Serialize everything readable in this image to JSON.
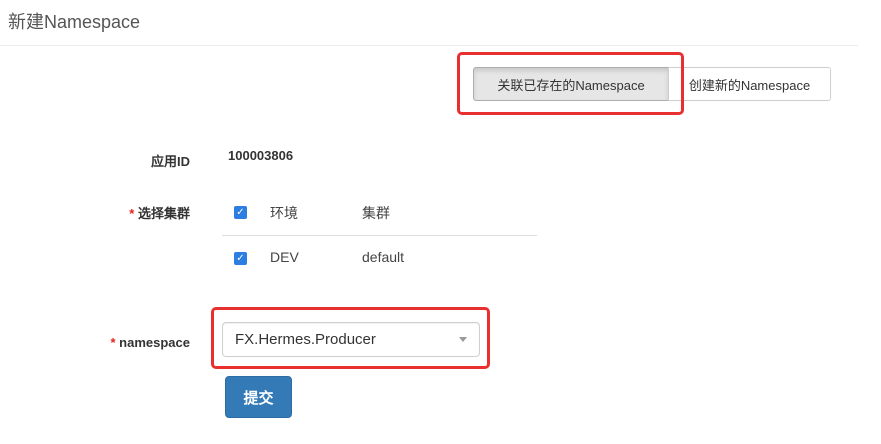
{
  "page": {
    "title": "新建Namespace"
  },
  "mode_buttons": {
    "link_existing": "关联已存在的Namespace",
    "create_new": "创建新的Namespace"
  },
  "form": {
    "app_id": {
      "label": "应用ID",
      "value": "100003806"
    },
    "clusters": {
      "required_mark": "*",
      "label": "选择集群",
      "header": {
        "env": "环境",
        "cluster": "集群",
        "checked": true
      },
      "rows": [
        {
          "env": "DEV",
          "cluster": "default",
          "checked": true
        }
      ]
    },
    "namespace": {
      "required_mark": "*",
      "label": "namespace",
      "selected": "FX.Hermes.Producer"
    },
    "submit_label": "提交"
  },
  "colors": {
    "highlight": "#e8302f",
    "primary": "#337ab7",
    "required": "#e2231a",
    "checkbox": "#2e7de1"
  },
  "icons": {
    "checkbox": "check-icon",
    "dropdown": "caret-down-icon"
  }
}
